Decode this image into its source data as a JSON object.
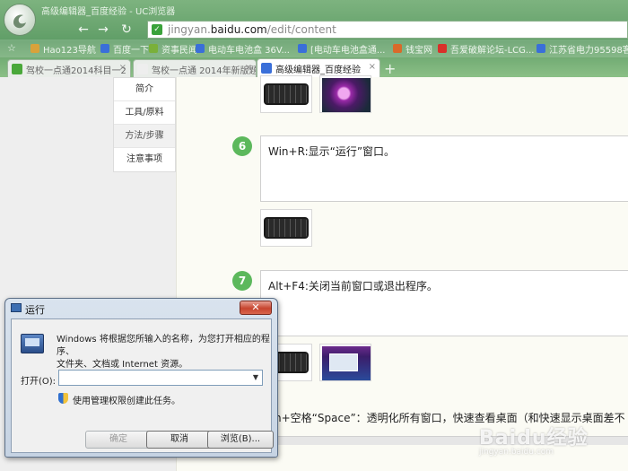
{
  "window": {
    "title": "高级编辑器_百度经验 - UC浏览器"
  },
  "nav": {
    "back": "←",
    "forward": "→",
    "refresh": "↻",
    "url_prefix": "jingyan.",
    "url_domain": "baidu.com",
    "url_path": "/edit/content"
  },
  "bookmarks": [
    {
      "label": "Hao123导航",
      "color": "#d9a23a"
    },
    {
      "label": "百度一下",
      "color": "#3a6fd9"
    },
    {
      "label": "资事民闻",
      "color": "#7ab03a"
    },
    {
      "label": "电动车电池盒 36V...",
      "color": "#3a6fd9"
    },
    {
      "label": "[电动车电池盒通...",
      "color": "#3a6fd9"
    },
    {
      "label": "钱宝网",
      "color": "#d96a2a"
    },
    {
      "label": "吾爱破解论坛-LCG...",
      "color": "#d9302a"
    },
    {
      "label": "江苏省电力95598客...",
      "color": "#3a6fd9"
    }
  ],
  "tabs": [
    {
      "label": "驾校一点通2014科目一2",
      "color": "#4aa83a"
    },
    {
      "label": "驾校一点通 2014年新版题",
      "color": "#eeeeee"
    },
    {
      "label": "高级编辑器_百度经验",
      "color": "#3a6fd9",
      "active": true
    }
  ],
  "sidebar": {
    "items": [
      "简介",
      "工具/原料",
      "方法/步骤",
      "注意事项"
    ]
  },
  "steps": [
    {
      "number": "6",
      "text": "Win+R:显示“运行”窗口。"
    },
    {
      "number": "7",
      "text": "Alt+F4:关闭当前窗口或退出程序。"
    }
  ],
  "bottom_text": "n+空格“Space”：透明化所有窗口，快速查看桌面（和快速显示桌面差不",
  "watermark": {
    "main": "Baidu经验",
    "sub": "jingyan.baidu.com"
  },
  "dialog": {
    "title": "运行",
    "close": "✕",
    "description_line1": "Windows 将根据您所输入的名称，为您打开相应的程序、",
    "description_line2": "文件夹、文档或 Internet 资源。",
    "open_label": "打开(O):",
    "input_value": "",
    "admin_text": "使用管理权限创建此任务。",
    "ok_label": "确定",
    "cancel_label": "取消",
    "browse_label": "浏览(B)..."
  }
}
